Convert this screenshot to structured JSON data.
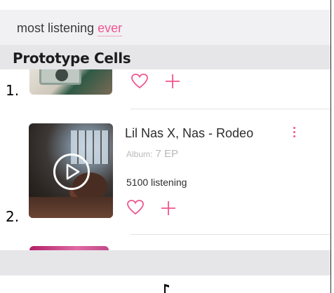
{
  "search": {
    "query": "most listening",
    "highlight": "ever"
  },
  "section": {
    "title": "Prototype Cells"
  },
  "cells": [
    {
      "index": "1."
    },
    {
      "index": "2.",
      "title": "Lil Nas X, Nas - Rodeo",
      "album_label": "Album:",
      "album_value": "7 EP",
      "listening": "5100 listening"
    }
  ],
  "icons": {
    "heart": "heart-icon",
    "plus": "plus-icon",
    "more": "more-vertical-icon",
    "play": "play-icon",
    "note": "music-note-icon"
  },
  "colors": {
    "accent": "#f0568f",
    "header_bg": "#e6e6e9",
    "search_bg": "#f1f1f3"
  }
}
